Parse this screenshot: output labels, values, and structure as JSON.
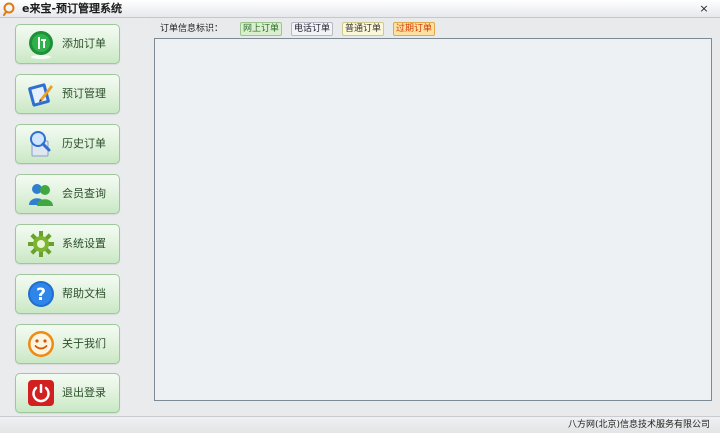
{
  "window": {
    "title": "e来宝-预订管理系统",
    "close_label": "×"
  },
  "sidebar": {
    "items": [
      {
        "label": "添加订单",
        "icon": "order-add-icon"
      },
      {
        "label": "预订管理",
        "icon": "booking-manage-icon"
      },
      {
        "label": "历史订单",
        "icon": "history-search-icon"
      },
      {
        "label": "会员查询",
        "icon": "members-icon"
      },
      {
        "label": "系统设置",
        "icon": "gear-icon"
      },
      {
        "label": "帮助文档",
        "icon": "help-icon"
      },
      {
        "label": "关于我们",
        "icon": "smiley-icon"
      },
      {
        "label": "退出登录",
        "icon": "power-icon"
      }
    ]
  },
  "legend": {
    "label": "订单信息标识：",
    "badges": [
      {
        "label": "网上订单",
        "color": "#2d6d2d"
      },
      {
        "label": "电话订单",
        "color": "#223344"
      },
      {
        "label": "普通订单",
        "color": "#333333"
      },
      {
        "label": "过期订单",
        "color": "#d13a00"
      }
    ]
  },
  "footer": {
    "company": "八方网(北京)信息技术服务有限公司"
  },
  "colors": {
    "accent_green": "#c9e8c4",
    "panel_bg": "#eef1f4",
    "window_bg": "#e8eaec"
  }
}
